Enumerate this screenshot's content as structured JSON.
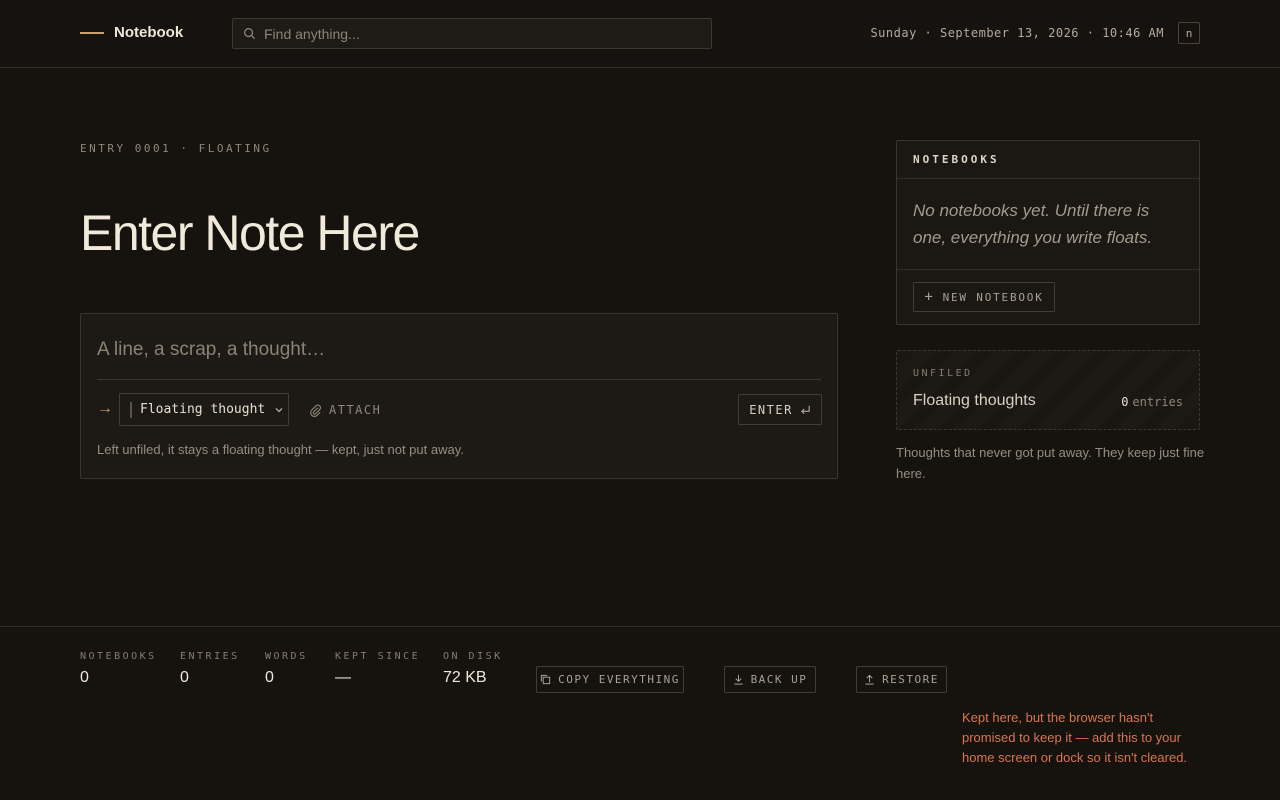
{
  "header": {
    "brand": "Notebook",
    "search_placeholder": "Find anything...",
    "datetime": "Sunday · September 13, 2026 · 10:46 AM",
    "shortcut_key": "n"
  },
  "main": {
    "entry_meta": "ENTRY 0001 · FLOATING",
    "title": "Enter Note Here",
    "composer": {
      "placeholder": "A line, a scrap, a thought…",
      "notebook_select": "Floating thought",
      "attach_label": "ATTACH",
      "enter_label": "ENTER",
      "hint": "Left unfiled, it stays a floating thought — kept, just not put away."
    }
  },
  "sidebar": {
    "notebooks_heading": "NOTEBOOKS",
    "notebooks_empty": "No notebooks yet. Until there is one, everything you write floats.",
    "new_notebook_label": "NEW NOTEBOOK",
    "unfiled": {
      "label": "UNFILED",
      "title": "Floating thoughts",
      "count": "0",
      "count_unit": "entries",
      "note": "Thoughts that never got put away. They keep just fine here."
    }
  },
  "footer": {
    "stats": [
      {
        "label": "NOTEBOOKS",
        "value": "0"
      },
      {
        "label": "ENTRIES",
        "value": "0"
      },
      {
        "label": "WORDS",
        "value": "0"
      },
      {
        "label": "KEPT SINCE",
        "value": "—"
      },
      {
        "label": "ON DISK",
        "value": "72 KB"
      }
    ],
    "copy_label": "COPY EVERYTHING",
    "backup_label": "BACK UP",
    "restore_label": "RESTORE",
    "warning": "Kept here, but the browser hasn't promised to keep it — add this to your home screen or dock so it isn't cleared."
  },
  "colors": {
    "background": "#16130f",
    "accent": "#c9a36a",
    "warning": "#d9754f"
  }
}
